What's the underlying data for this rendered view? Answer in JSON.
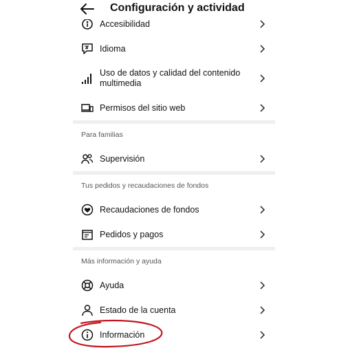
{
  "header": {
    "title": "Configuración y actividad"
  },
  "items": {
    "accesibilidad": "Accesibilidad",
    "idioma": "Idioma",
    "uso_datos": "Uso de datos y calidad del contenido multimedia",
    "permisos": "Permisos del sitio web",
    "supervision": "Supervisión",
    "recaudaciones": "Recaudaciones de fondos",
    "pedidos": "Pedidos y pagos",
    "ayuda": "Ayuda",
    "estado_cuenta": "Estado de la cuenta",
    "informacion": "Información"
  },
  "sections": {
    "familias": "Para familias",
    "pedidos": "Tus pedidos y recaudaciones de fondos",
    "ayuda": "Más información y ayuda"
  },
  "icons": {
    "back": "arrow-left-icon",
    "chevron": "chevron-right-icon"
  },
  "colors": {
    "annotation": "#c0161f",
    "divider": "#efefef"
  }
}
